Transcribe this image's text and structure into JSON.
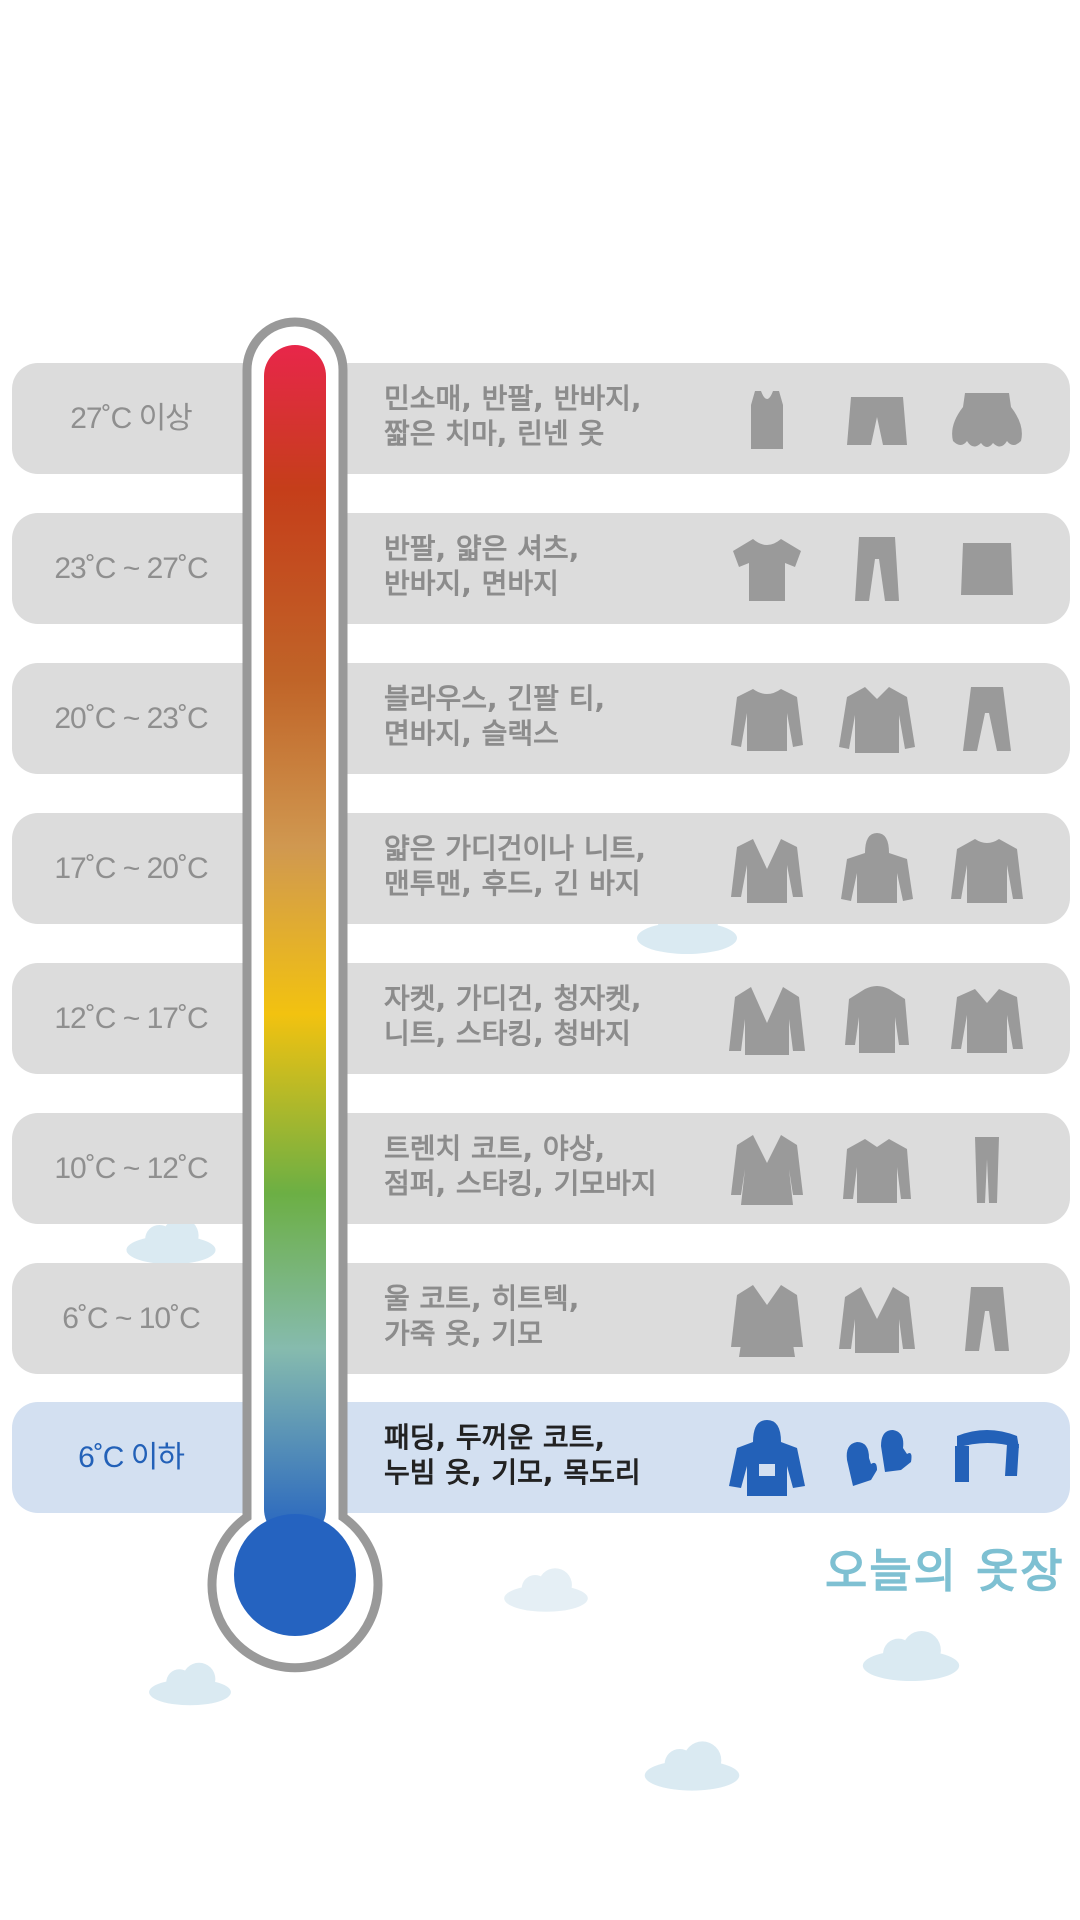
{
  "title": "오늘의 옷장",
  "colors": {
    "inactive": "#9a9a9a",
    "active": "#2361b8",
    "title": "#7ec0d2"
  },
  "rows": [
    {
      "temp": "27˚C 이상",
      "clothes": "민소매, 반팔, 반바지,\n짧은 치마, 린넨 옷",
      "icons": [
        "sleeveless-icon",
        "shorts-icon",
        "skirt-icon"
      ]
    },
    {
      "temp": "23˚C ~ 27˚C",
      "clothes": "반팔, 얇은 셔츠,\n반바지, 면바지",
      "icons": [
        "tshirt-icon",
        "cotton-pants-icon",
        "short-skirt-icon"
      ]
    },
    {
      "temp": "20˚C ~ 23˚C",
      "clothes": "블라우스, 긴팔 티,\n면바지, 슬랙스",
      "icons": [
        "long-sleeve-icon",
        "blouse-icon",
        "slacks-icon"
      ]
    },
    {
      "temp": "17˚C ~ 20˚C",
      "clothes": "얇은 가디건이나 니트,\n맨투맨, 후드, 긴 바지",
      "icons": [
        "cardigan-icon",
        "hoodie-icon",
        "sweatshirt-icon"
      ]
    },
    {
      "temp": "12˚C ~ 17˚C",
      "clothes": "자켓, 가디건, 청자켓,\n니트, 스타킹, 청바지",
      "icons": [
        "jacket-icon",
        "zip-jacket-icon",
        "knit-icon"
      ]
    },
    {
      "temp": "10˚C ~ 12˚C",
      "clothes": "트렌치 코트, 야상,\n점퍼, 스타킹, 기모바지",
      "icons": [
        "trench-coat-icon",
        "field-jacket-icon",
        "leggings-icon"
      ]
    },
    {
      "temp": "6˚C ~ 10˚C",
      "clothes": "울 코트, 히트텍,\n가죽 옷, 기모",
      "icons": [
        "wool-coat-icon",
        "leather-jacket-icon",
        "fleece-pants-icon"
      ]
    },
    {
      "temp": "6˚C 이하",
      "clothes": "패딩, 두꺼운 코트,\n누빔 옷, 기모, 목도리",
      "icons": [
        "padded-coat-icon",
        "mittens-icon",
        "scarf-icon"
      ],
      "active": true
    }
  ]
}
